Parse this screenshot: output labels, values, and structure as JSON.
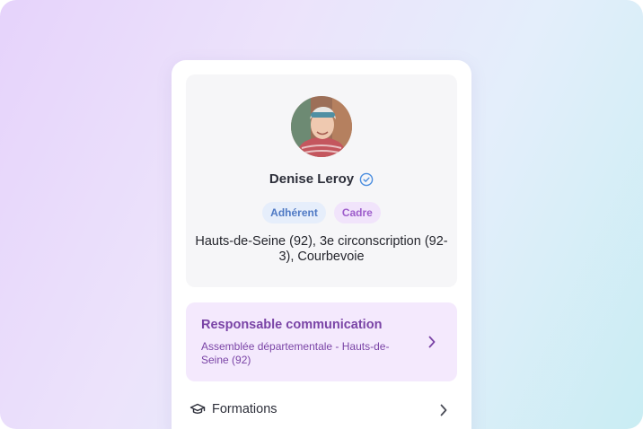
{
  "profile": {
    "name": "Denise Leroy",
    "avatar_icon": "avatar-photo",
    "verified_icon": "verified-check-icon",
    "badges": [
      {
        "label": "Adhérent",
        "color": "#4f79c4"
      },
      {
        "label": "Cadre",
        "color": "#9d5dcb"
      }
    ],
    "location": "Hauts-de-Seine (92), 3e circonscription (92-3), Courbevoie"
  },
  "role": {
    "title": "Responsable communication",
    "subtitle": "Assemblée départementale - Hauts-de-Seine (92)",
    "icon": "chevron-right-icon"
  },
  "menu": {
    "formations": {
      "label": "Formations",
      "icon": "graduation-cap-icon"
    }
  }
}
